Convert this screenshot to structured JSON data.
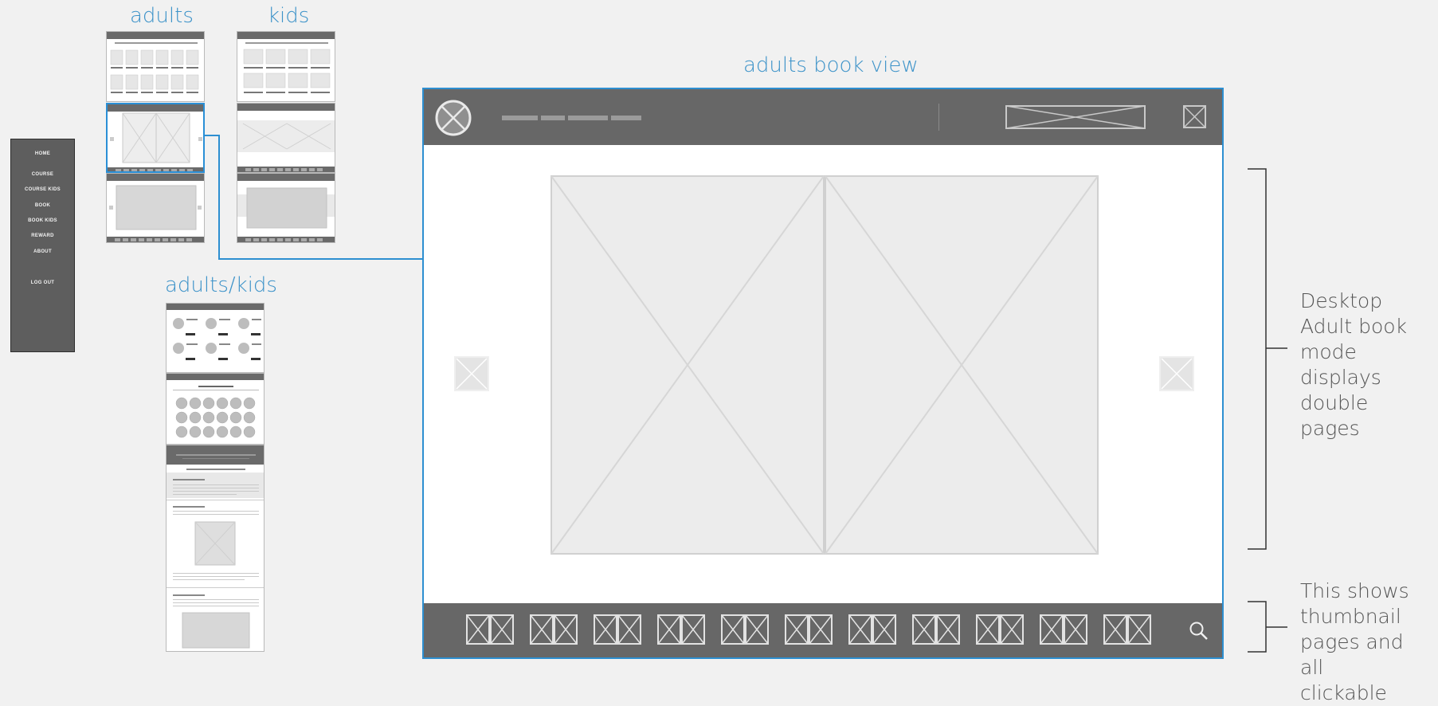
{
  "labels": {
    "adults": "adults",
    "kids": "kids",
    "adults_kids": "adults/kids",
    "book_view": "adults book view"
  },
  "menu": {
    "items": [
      "HOME",
      "COURSE",
      "COURSE KIDS",
      "BOOK",
      "BOOK KIDS",
      "REWARD",
      "ABOUT",
      "LOG OUT"
    ]
  },
  "notes": {
    "desktop": "Desktop Adult book mode displays double pages",
    "thumbs": "This shows thumbnail pages and all clickable"
  },
  "colors": {
    "accent": "#2d8fd1",
    "bar": "#676767",
    "placeholder": "#ececec"
  },
  "icons": {
    "logo": "circle-x-logo-icon",
    "close": "close-box-icon",
    "search": "search-icon",
    "prev": "prev-page-icon",
    "next": "next-page-icon"
  }
}
